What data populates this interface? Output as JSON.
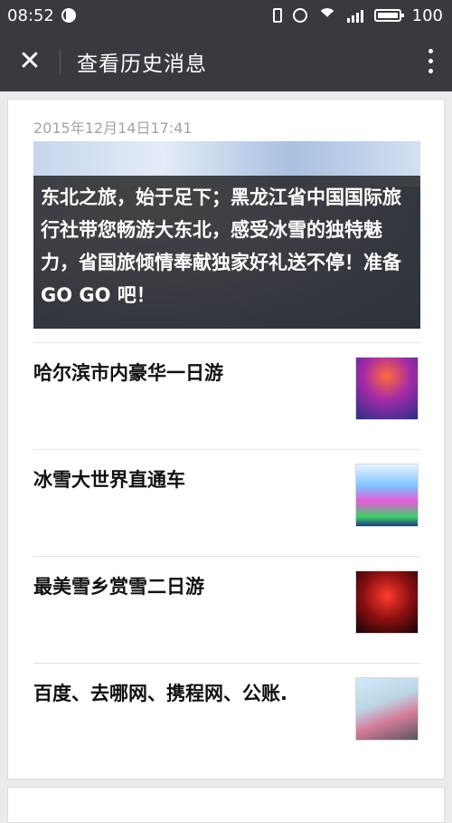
{
  "status": {
    "time": "08:52",
    "battery": "100"
  },
  "header": {
    "title": "查看历史消息"
  },
  "message": {
    "date": "2015年12月14日17:41",
    "hero_caption": "东北之旅，始于足下；黑龙江省中国国际旅行社带您畅游大东北，感受冰雪的独特魅力，省国旅倾情奉献独家好礼送不停！准备GO GO 吧！",
    "items": [
      {
        "title": "哈尔滨市内豪华一日游"
      },
      {
        "title": "冰雪大世界直通车"
      },
      {
        "title": "最美雪乡赏雪二日游"
      },
      {
        "title": "百度、去哪网、携程网、公账."
      }
    ]
  }
}
